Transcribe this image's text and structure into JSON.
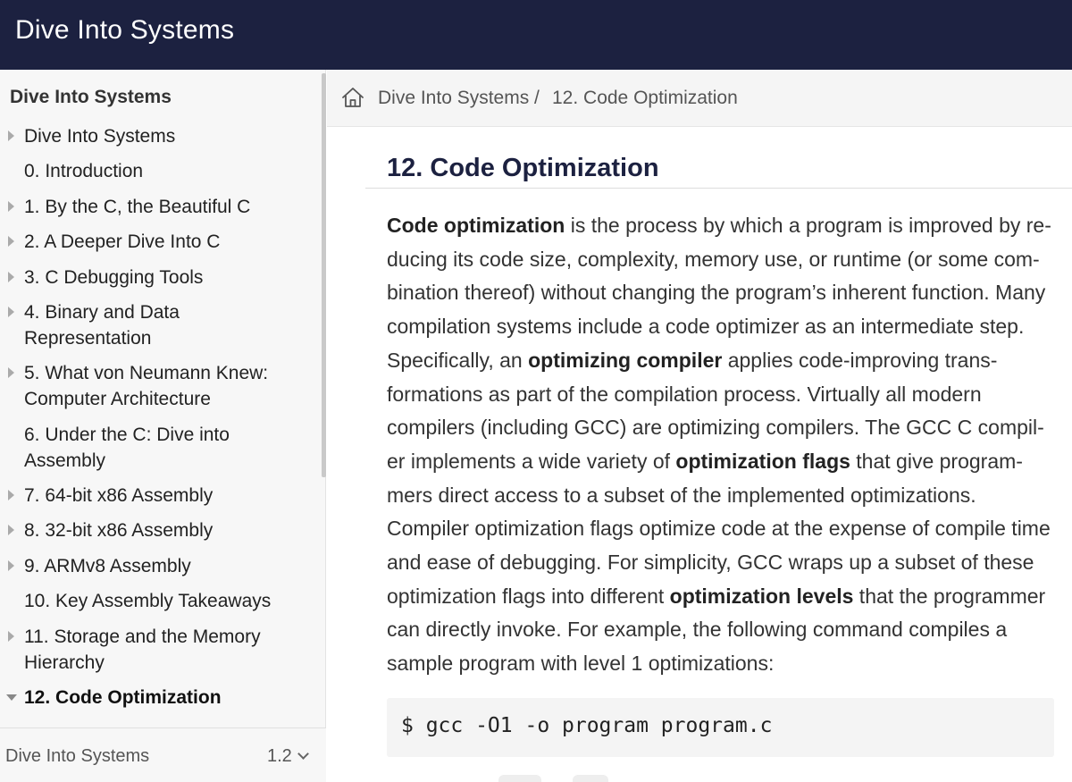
{
  "header": {
    "site_title": "Dive Into Systems"
  },
  "sidebar": {
    "title": "Dive Into Systems",
    "items": [
      {
        "label": "Dive Into Systems",
        "caret": "collapsed",
        "active": false
      },
      {
        "label": "0. Introduction",
        "caret": "none",
        "active": false
      },
      {
        "label": "1. By the C, the Beautiful C",
        "caret": "collapsed",
        "active": false
      },
      {
        "label": "2. A Deeper Dive Into C",
        "caret": "collapsed",
        "active": false
      },
      {
        "label": "3. C Debugging Tools",
        "caret": "collapsed",
        "active": false
      },
      {
        "label": "4. Binary and Data Representation",
        "caret": "collapsed",
        "active": false
      },
      {
        "label": "5. What von Neumann Knew: Computer Architecture",
        "caret": "collapsed",
        "active": false
      },
      {
        "label": "6. Under the C: Dive into Assembly",
        "caret": "none",
        "active": false
      },
      {
        "label": "7. 64-bit x86 Assembly",
        "caret": "collapsed",
        "active": false
      },
      {
        "label": "8. 32-bit x86 Assembly",
        "caret": "collapsed",
        "active": false
      },
      {
        "label": "9. ARMv8 Assembly",
        "caret": "collapsed",
        "active": false
      },
      {
        "label": "10. Key Assembly Takeaways",
        "caret": "none",
        "active": false
      },
      {
        "label": "11. Storage and the Memory Hierarchy",
        "caret": "collapsed",
        "active": false
      },
      {
        "label": "12. Code Optimization",
        "caret": "expanded",
        "active": true
      }
    ],
    "footer": {
      "book_name": "Dive Into Systems",
      "version": "1.2"
    }
  },
  "breadcrumb": {
    "items": [
      "Dive Into Systems",
      "12. Code Optimization"
    ],
    "separator": "/"
  },
  "main": {
    "page_title": "12. Code Optimization",
    "paragraph": {
      "t1_bold": "Code optimization",
      "t2": " is the process by which a program is improved by re­ducing its code size, complexity, memory use, or runtime (or some com­bination thereof) without changing the program’s inherent function. Many compilation systems include a code optimizer as an intermediate step. Specifically, an ",
      "t3_bold": "optimizing compiler",
      "t4": " applies code-improving trans­formations as part of the compilation process. Virtually all modern compilers (including GCC) are optimizing compilers. The GCC C compil­er implements a wide variety of ",
      "t5_bold": "optimization flags",
      "t6": " that give program­mers direct access to a subset of the implemented optimizations. Compiler optimization flags optimize code at the expense of compile time and ease of debugging. For simplicity, GCC wraps up a subset of these optimization flags into different ",
      "t7_bold": "optimization levels",
      "t8": " that the pro­grammer can directly invoke. For example, the following command compiles a sample program with level 1 optimizations:"
    },
    "code_block": "$ gcc -O1 -o program program.c"
  },
  "colors": {
    "header_bg": "#1c2140",
    "title_color": "#1c2140",
    "sidebar_bg": "#f7f7f7"
  },
  "icons": {
    "home": "home-icon",
    "caret": "caret-icon",
    "version_chevron": "chevron-down-icon"
  }
}
